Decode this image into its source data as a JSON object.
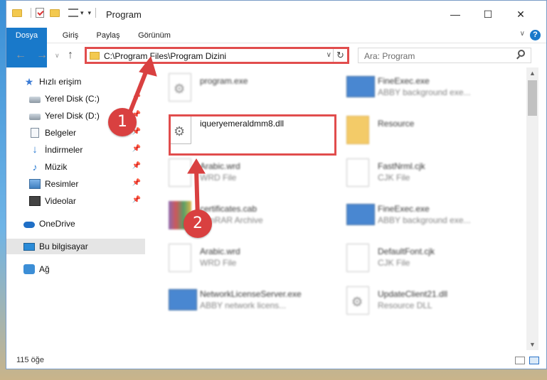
{
  "window": {
    "title": "Program",
    "controls": {
      "minimize": "—",
      "maximize": "☐",
      "close": "✕"
    }
  },
  "ribbon": {
    "tabs": [
      "Dosya",
      "Giriş",
      "Paylaş",
      "Görünüm"
    ],
    "help": "?"
  },
  "address": {
    "path": "C:\\Program Files\\Program Dizini",
    "search_placeholder": "Ara: Program"
  },
  "sidebar": {
    "items": [
      {
        "label": "Hızlı erişim",
        "icon": "star-icon",
        "pinned": false
      },
      {
        "label": "Yerel Disk (C:)",
        "icon": "disk-icon",
        "pinned": true
      },
      {
        "label": "Yerel Disk (D:)",
        "icon": "disk-icon",
        "pinned": true
      },
      {
        "label": "Belgeler",
        "icon": "documents-icon",
        "pinned": true
      },
      {
        "label": "İndirmeler",
        "icon": "download-icon",
        "pinned": true
      },
      {
        "label": "Müzik",
        "icon": "music-icon",
        "pinned": true
      },
      {
        "label": "Resimler",
        "icon": "pictures-icon",
        "pinned": true
      },
      {
        "label": "Videolar",
        "icon": "videos-icon",
        "pinned": true
      },
      {
        "label": "OneDrive",
        "icon": "onedrive-icon",
        "pinned": false
      },
      {
        "label": "Bu bilgisayar",
        "icon": "this-pc-icon",
        "pinned": false,
        "selected": true
      },
      {
        "label": "Ağ",
        "icon": "network-icon",
        "pinned": false
      }
    ]
  },
  "files": [
    {
      "name": "program.exe",
      "sub": "",
      "icon": "exe-icon",
      "blurred": true
    },
    {
      "name": "FineExec.exe",
      "sub": "ABBY background exe...",
      "icon": "exe-icon",
      "blurred": true
    },
    {
      "name": "iqueryemeraldmm8.dll",
      "sub": "",
      "icon": "dll-gear-icon",
      "blurred": false,
      "highlighted": true
    },
    {
      "name": "Resource",
      "sub": "",
      "icon": "folder-icon",
      "blurred": true
    },
    {
      "name": "Arabic.wrd",
      "sub": "WRD File",
      "icon": "file-icon",
      "blurred": true
    },
    {
      "name": "FastNrml.cjk",
      "sub": "CJK File",
      "icon": "file-icon",
      "blurred": true
    },
    {
      "name": "certificates.cab",
      "sub": "WinRAR Archive",
      "icon": "rar-icon",
      "blurred": true
    },
    {
      "name": "FineExec.exe",
      "sub": "ABBY background exe...",
      "icon": "exe-icon",
      "blurred": true
    },
    {
      "name": "Arabic.wrd",
      "sub": "WRD File",
      "icon": "file-icon",
      "blurred": true
    },
    {
      "name": "DefaultFont.cjk",
      "sub": "CJK File",
      "icon": "file-icon",
      "blurred": true
    },
    {
      "name": "NetworkLicenseServer.exe",
      "sub": "ABBY network licens...",
      "icon": "exe-icon",
      "blurred": true
    },
    {
      "name": "UpdateClient21.dll",
      "sub": "Resource DLL",
      "icon": "dll-gear-icon",
      "blurred": true
    }
  ],
  "status": {
    "count": "115 öğe"
  },
  "annotations": [
    "1",
    "2"
  ],
  "colors": {
    "accent": "#1979ca",
    "annotation": "#e14d4d"
  }
}
